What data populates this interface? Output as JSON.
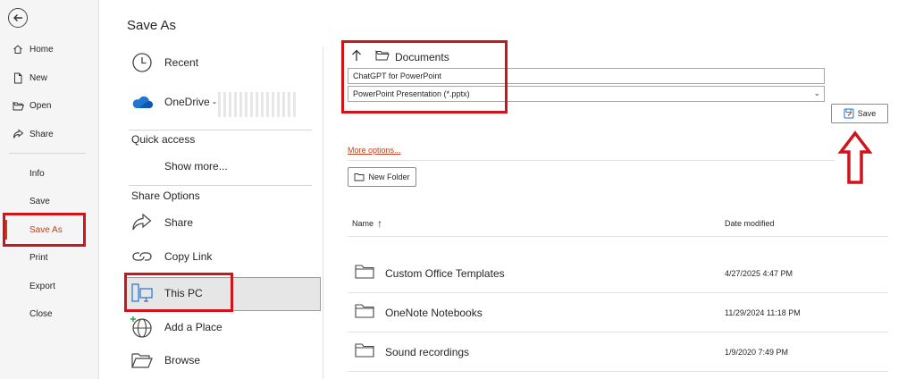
{
  "nav": {
    "items": [
      {
        "label": "Home",
        "icon": "home-icon"
      },
      {
        "label": "New",
        "icon": "new-document-icon"
      },
      {
        "label": "Open",
        "icon": "open-folder-icon"
      },
      {
        "label": "Share",
        "icon": "share-icon"
      },
      {
        "label": "Info"
      },
      {
        "label": "Save"
      },
      {
        "label": "Save As",
        "active": true
      },
      {
        "label": "Print"
      },
      {
        "label": "Export"
      },
      {
        "label": "Close"
      }
    ]
  },
  "page": {
    "title": "Save As"
  },
  "locations": {
    "recent": "Recent",
    "onedrive": "OneDrive - ",
    "quick_access": "Quick access",
    "show_more": "Show more...",
    "share_options": "Share Options",
    "share": "Share",
    "copy_link": "Copy Link",
    "this_pc": "This PC",
    "add_place": "Add a Place",
    "browse": "Browse"
  },
  "save_panel": {
    "folder": "Documents",
    "filename": "ChatGPT for PowerPoint",
    "filetype": "PowerPoint Presentation (*.pptx)",
    "save_label": "Save",
    "more_options": "More options...",
    "new_folder": "New Folder",
    "columns": {
      "name": "Name",
      "date": "Date modified"
    },
    "files": [
      {
        "name": "Custom Office Templates",
        "date": "4/27/2025 4:47 PM"
      },
      {
        "name": "OneNote Notebooks",
        "date": "11/29/2024 11:18 PM"
      },
      {
        "name": "Sound recordings",
        "date": "1/9/2020 7:49 PM"
      }
    ]
  },
  "colors": {
    "accent": "#c43e1c",
    "highlight_red": "#d1141c"
  }
}
